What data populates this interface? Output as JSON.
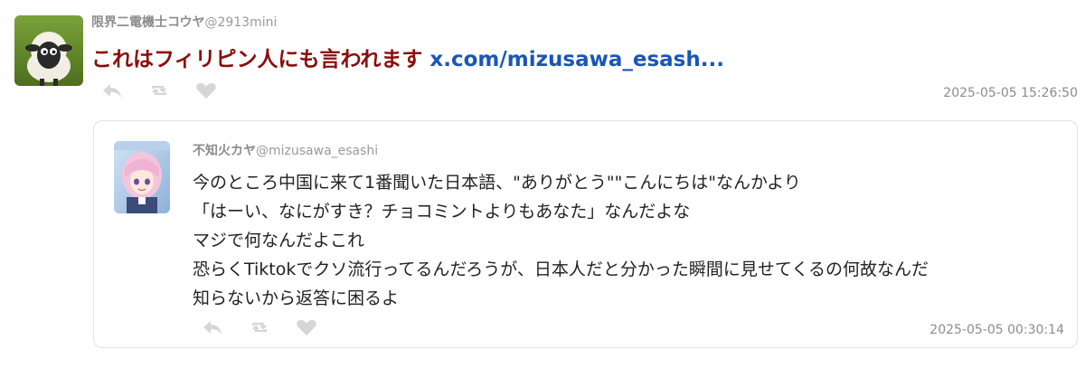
{
  "tweet": {
    "author_name": "限界二電機士コウヤ",
    "author_handle": "@2913mini",
    "text": "これはフィリピン人にも言われます",
    "link_text": "x.com/mizusawa_esash...",
    "timestamp": "2025-05-05 15:26:50",
    "actions": [
      "reply-icon",
      "retweet-icon",
      "like-icon"
    ]
  },
  "quoted": {
    "author_name": "不知火カヤ",
    "author_handle": "@mizusawa_esashi",
    "lines": [
      "今のところ中国に来て1番聞いた日本語、\"ありがとう\"\"こんにちは\"なんかより",
      "「はーい、なにがすき？チョコミントよりもあなた」なんだよな",
      "マジで何なんだよこれ",
      "恐らくTiktokでクソ流行ってるんだろうが、日本人だと分かった瞬間に見せてくるの何故なんだ",
      "知らないから返答に困るよ"
    ],
    "timestamp": "2025-05-05 00:30:14",
    "actions": [
      "reply-icon",
      "retweet-icon",
      "like-icon"
    ]
  },
  "colors": {
    "accent_red": "#8b0d0d",
    "link_blue": "#1a56b8",
    "muted_gray": "#8c8c8c",
    "icon_gray": "#d6d6d6"
  }
}
